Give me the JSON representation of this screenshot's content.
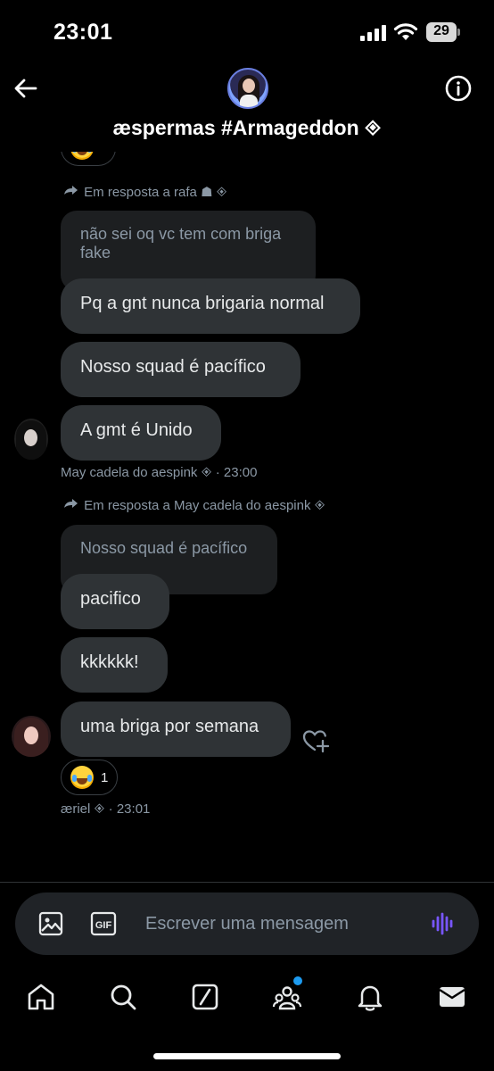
{
  "status_bar": {
    "time": "23:01",
    "battery": "29"
  },
  "header": {
    "title": "æspermas #Armageddon 🞚"
  },
  "messages": [
    {
      "type": "reply-label",
      "text": "Em resposta a rafa ☗ 🞚"
    },
    {
      "type": "quoted",
      "text": "não sei oq vc tem com briga fake"
    },
    {
      "type": "bubble",
      "text": "Pq a gnt nunca brigaria normal"
    },
    {
      "type": "bubble",
      "text": "Nosso squad é pacífico"
    },
    {
      "type": "bubble",
      "text": "A gmt é Unido"
    },
    {
      "type": "meta",
      "text": "May cadela do aespink 🞚 · 23:00"
    },
    {
      "type": "reply-label",
      "text": "Em resposta a May cadela do aespink 🞚"
    },
    {
      "type": "quoted",
      "text": "Nosso squad é pacífico"
    },
    {
      "type": "bubble",
      "text": "pacifico"
    },
    {
      "type": "bubble",
      "text": "kkkkkk!"
    },
    {
      "type": "bubble",
      "text": "uma briga por semana"
    },
    {
      "type": "reaction",
      "emoji": "joy-emoji",
      "count": "1"
    },
    {
      "type": "meta",
      "text": "æriel 🞚 · 23:01"
    }
  ],
  "composer": {
    "placeholder": "Escrever uma mensagem",
    "gif_label": "GIF"
  },
  "nav": [
    "home-icon",
    "search-icon",
    "grok-icon",
    "communities-icon",
    "notifications-icon",
    "messages-icon"
  ],
  "colors": {
    "bubble": "#2f3336",
    "quoted": "#1d1f21",
    "accent": "#1d9bf0",
    "voice": "#7856ff"
  }
}
